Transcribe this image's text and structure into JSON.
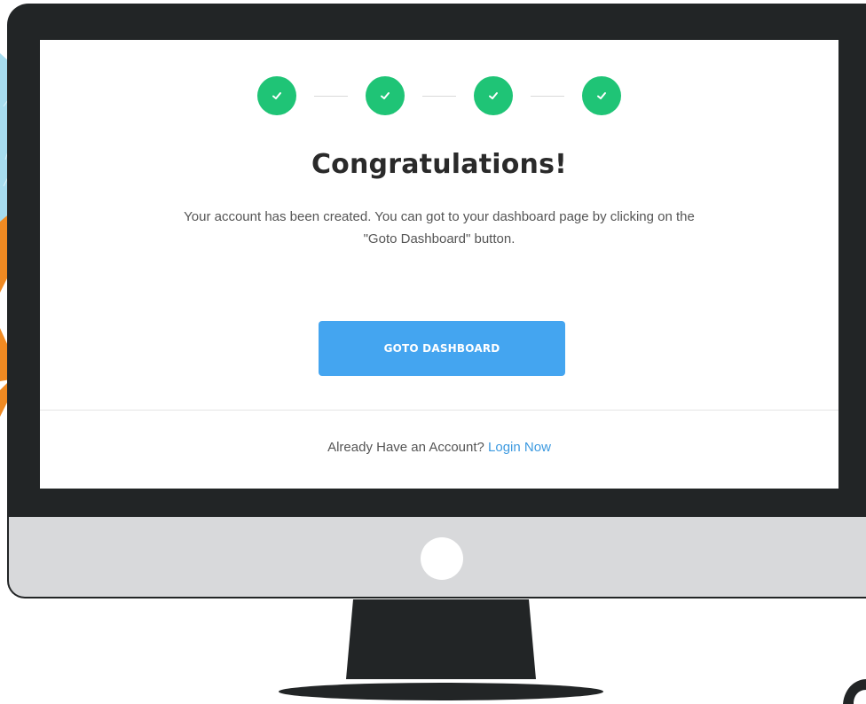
{
  "steps": [
    {
      "status": "complete",
      "icon": "checkmark-icon"
    },
    {
      "status": "complete",
      "icon": "checkmark-icon"
    },
    {
      "status": "complete",
      "icon": "checkmark-icon"
    },
    {
      "status": "complete",
      "icon": "checkmark-icon"
    }
  ],
  "heading": "Congratulations!",
  "message": "Your account has been created. You can got to your dashboard page by clicking on the \"Goto Dashboard\" button.",
  "cta": {
    "label": "GOTO DASHBOARD"
  },
  "footer": {
    "prompt": "Already Have an Account?",
    "link_label": "Login Now"
  },
  "colors": {
    "step_complete": "#1fc476",
    "primary_button": "#44a5f0",
    "link": "#3d9ae0",
    "monitor_frame": "#222526",
    "monitor_chin": "#d8d9db"
  }
}
